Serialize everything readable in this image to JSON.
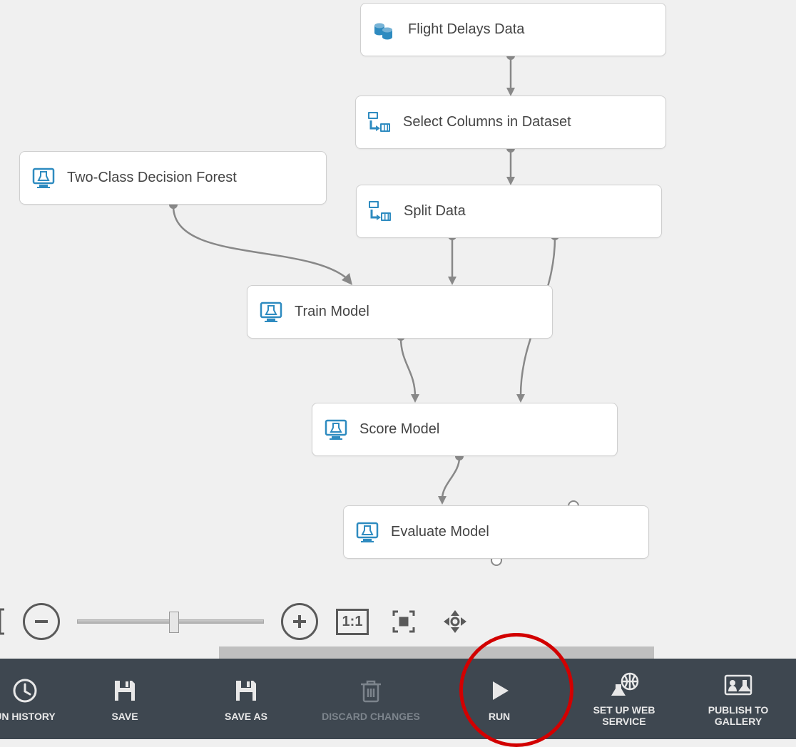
{
  "nodes": {
    "flight_delays": "Flight Delays Data",
    "select_columns": "Select Columns in Dataset",
    "two_class_forest": "Two-Class Decision Forest",
    "split_data": "Split Data",
    "train_model": "Train Model",
    "score_model": "Score Model",
    "evaluate_model": "Evaluate Model"
  },
  "footer": {
    "history": "UN HISTORY",
    "save": "SAVE",
    "save_as": "SAVE AS",
    "discard": "DISCARD CHANGES",
    "run": "RUN",
    "web_service": "SET UP WEB\nSERVICE",
    "publish": "PUBLISH TO\nGALLERY"
  },
  "zoom": {
    "one_to_one": "1:1"
  }
}
